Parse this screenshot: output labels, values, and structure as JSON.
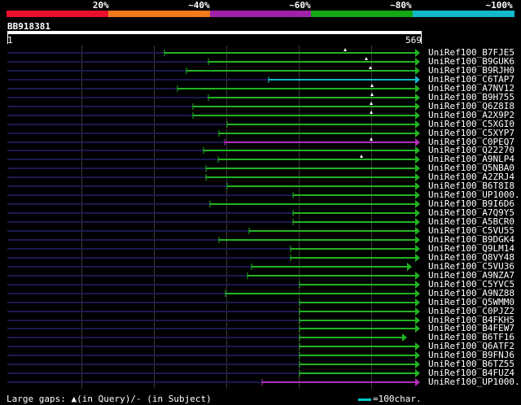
{
  "legend": {
    "colors": [
      "#e8102b",
      "#f07a1c",
      "#a020a8",
      "#14a814",
      "#14b8c8"
    ],
    "labels": [
      "20%",
      "~40%",
      "~60%",
      "~80%",
      "~100%"
    ]
  },
  "query": {
    "name": "BB918381",
    "start": "1",
    "end": "569"
  },
  "hits": [
    {
      "label": "UniRef100_B7FJE5",
      "start": 202,
      "end": 510,
      "color": "#22b422",
      "gaps": [
        424
      ]
    },
    {
      "label": "UniRef100_B9GUK6",
      "start": 256,
      "end": 510,
      "color": "#22b422",
      "gaps": [
        450
      ]
    },
    {
      "label": "UniRef100_B9RJH0",
      "start": 229,
      "end": 510,
      "color": "#22b422",
      "gaps": [
        455
      ]
    },
    {
      "label": "UniRef100_C6TAP7",
      "start": 330,
      "end": 510,
      "color": "#14b8c8",
      "gaps": []
    },
    {
      "label": "UniRef100_A7NV12",
      "start": 218,
      "end": 510,
      "color": "#22b422",
      "gaps": [
        457
      ]
    },
    {
      "label": "UniRef100_B9H755",
      "start": 256,
      "end": 510,
      "color": "#22b422",
      "gaps": [
        457
      ]
    },
    {
      "label": "UniRef100_Q6Z8I8",
      "start": 237,
      "end": 510,
      "color": "#22b422",
      "gaps": [
        456
      ]
    },
    {
      "label": "UniRef100_A2X9P2",
      "start": 237,
      "end": 510,
      "color": "#22b422",
      "gaps": [
        456
      ]
    },
    {
      "label": "UniRef100_C5XGI0",
      "start": 279,
      "end": 510,
      "color": "#22b422",
      "gaps": []
    },
    {
      "label": "UniRef100_C5XYP7",
      "start": 269,
      "end": 510,
      "color": "#22b422",
      "gaps": []
    },
    {
      "label": "UniRef100_C0PEQ7",
      "start": 276,
      "end": 510,
      "color": "#b030b8",
      "gaps": [
        456
      ]
    },
    {
      "label": "UniRef100_Q22270",
      "start": 250,
      "end": 510,
      "color": "#22b422",
      "gaps": []
    },
    {
      "label": "UniRef100_A9NLP4",
      "start": 268,
      "end": 510,
      "color": "#22b422",
      "gaps": [
        444
      ]
    },
    {
      "label": "UniRef100_Q5NBA0",
      "start": 253,
      "end": 510,
      "color": "#22b422",
      "gaps": []
    },
    {
      "label": "UniRef100_A2ZRJ4",
      "start": 253,
      "end": 510,
      "color": "#22b422",
      "gaps": []
    },
    {
      "label": "UniRef100_B6T8I8",
      "start": 279,
      "end": 510,
      "color": "#22b422",
      "gaps": []
    },
    {
      "label": "UniRef100_UP1000..",
      "start": 360,
      "end": 510,
      "color": "#22b422",
      "gaps": []
    },
    {
      "label": "UniRef100_B9I6D6",
      "start": 258,
      "end": 510,
      "color": "#22b422",
      "gaps": []
    },
    {
      "label": "UniRef100_A7Q9Y5",
      "start": 360,
      "end": 510,
      "color": "#22b422",
      "gaps": []
    },
    {
      "label": "UniRef100_A5BCR0",
      "start": 360,
      "end": 510,
      "color": "#22b422",
      "gaps": []
    },
    {
      "label": "UniRef100_C5VU55",
      "start": 306,
      "end": 510,
      "color": "#22b422",
      "gaps": []
    },
    {
      "label": "UniRef100_B9DGK4",
      "start": 269,
      "end": 510,
      "color": "#22b422",
      "gaps": []
    },
    {
      "label": "UniRef100_Q9LM14",
      "start": 357,
      "end": 510,
      "color": "#22b422",
      "gaps": []
    },
    {
      "label": "UniRef100_Q8VY48",
      "start": 357,
      "end": 510,
      "color": "#22b422",
      "gaps": []
    },
    {
      "label": "UniRef100_C5VU36",
      "start": 309,
      "end": 500,
      "color": "#22b422",
      "gaps": []
    },
    {
      "label": "UniRef100_A9NZA7",
      "start": 304,
      "end": 510,
      "color": "#22b422",
      "gaps": []
    },
    {
      "label": "UniRef100_C5YVC5",
      "start": 368,
      "end": 510,
      "color": "#22b422",
      "gaps": []
    },
    {
      "label": "UniRef100_A9NZ88",
      "start": 277,
      "end": 510,
      "color": "#22b422",
      "gaps": []
    },
    {
      "label": "UniRef100_Q5WMM0",
      "start": 368,
      "end": 510,
      "color": "#22b422",
      "gaps": []
    },
    {
      "label": "UniRef100_C0PJZ2",
      "start": 368,
      "end": 510,
      "color": "#22b422",
      "gaps": []
    },
    {
      "label": "UniRef100_B4FKH5",
      "start": 368,
      "end": 510,
      "color": "#22b422",
      "gaps": []
    },
    {
      "label": "UniRef100_B4FEW7",
      "start": 368,
      "end": 510,
      "color": "#22b422",
      "gaps": []
    },
    {
      "label": "UniRef100_B6TF16",
      "start": 368,
      "end": 494,
      "color": "#22b422",
      "gaps": []
    },
    {
      "label": "UniRef100_Q6ATF2",
      "start": 368,
      "end": 510,
      "color": "#22b422",
      "gaps": []
    },
    {
      "label": "UniRef100_B9FNJ6",
      "start": 368,
      "end": 510,
      "color": "#22b422",
      "gaps": []
    },
    {
      "label": "UniRef100_B6TZ55",
      "start": 368,
      "end": 510,
      "color": "#22b422",
      "gaps": []
    },
    {
      "label": "UniRef100_B4FUZ4",
      "start": 368,
      "end": 510,
      "color": "#22b422",
      "gaps": []
    },
    {
      "label": "UniRef100_UP1000..",
      "start": 322,
      "end": 510,
      "color": "#b030b8",
      "gaps": []
    }
  ],
  "footer": {
    "large_gaps": "Large gaps:",
    "in_query_symbol": "▲",
    "in_query": "(in Query)/",
    "in_subject_symbol": "-",
    "in_subject": "(in Subject)",
    "scale_label": "=100char."
  }
}
